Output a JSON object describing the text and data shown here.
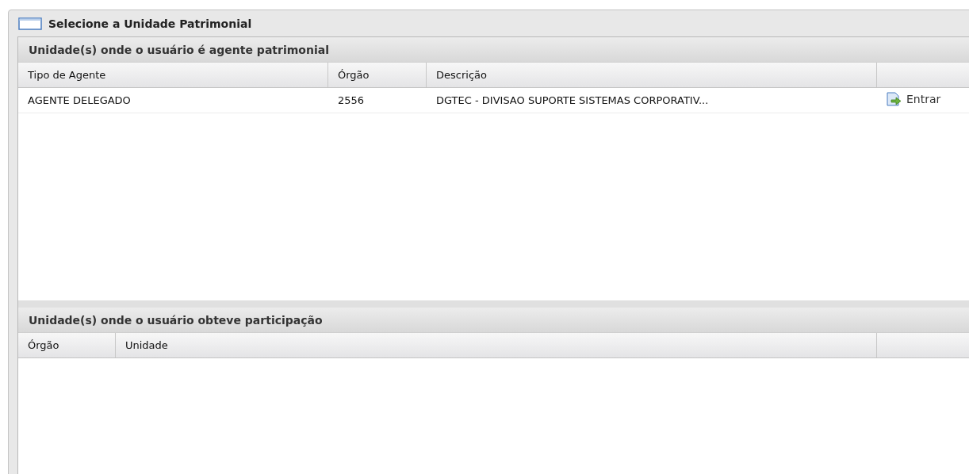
{
  "window": {
    "title": "Selecione a Unidade Patrimonial"
  },
  "panels": [
    {
      "title": "Unidade(s) onde o usuário é agente patrimonial",
      "kind": "agent",
      "columns": [
        "Tipo de Agente",
        "Órgão",
        "Descrição"
      ],
      "rows": [
        {
          "tipo": "AGENTE DELEGADO",
          "orgao": "2556",
          "descricao": "DGTEC - DIVISAO SUPORTE SISTEMAS CORPORATIV...",
          "action": "Entrar"
        }
      ]
    },
    {
      "title": "Unidade(s) onde o usuário obteve participação",
      "kind": "participation",
      "columns": [
        "Órgão",
        "Unidade"
      ]
    }
  ]
}
